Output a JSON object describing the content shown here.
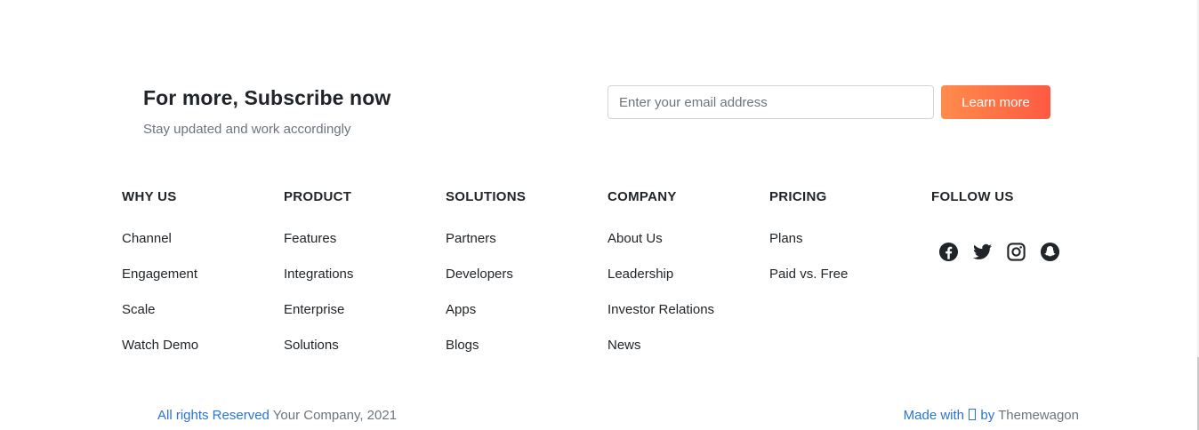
{
  "subscribe": {
    "title": "For more, Subscribe now",
    "subtitle": "Stay updated and work accordingly",
    "email_placeholder": "Enter your email address",
    "button_label": "Learn more"
  },
  "columns": [
    {
      "heading": "WHY US",
      "links": [
        "Channel",
        "Engagement",
        "Scale",
        "Watch Demo"
      ]
    },
    {
      "heading": "PRODUCT",
      "links": [
        "Features",
        "Integrations",
        "Enterprise",
        "Solutions"
      ]
    },
    {
      "heading": "SOLUTIONS",
      "links": [
        "Partners",
        "Developers",
        "Apps",
        "Blogs"
      ]
    },
    {
      "heading": "COMPANY",
      "links": [
        "About Us",
        "Leadership",
        "Investor Relations",
        "News"
      ]
    },
    {
      "heading": "PRICING",
      "links": [
        "Plans",
        "Paid vs. Free"
      ]
    }
  ],
  "follow": {
    "heading": "FOLLOW US",
    "icons": [
      "facebook-icon",
      "twitter-icon",
      "instagram-icon",
      "snapchat-icon"
    ]
  },
  "footer": {
    "rights_link": "All rights Reserved",
    "company": " Your Company, 2021",
    "made_with": "Made with",
    "by": "by",
    "author": " Themewagon"
  },
  "colors": {
    "accent_blue": "#2a74d6",
    "button_gradient_start": "#ff8c4b",
    "button_gradient_end": "#fe5a43",
    "text_dark": "#212529",
    "text_muted": "#6c757d"
  }
}
